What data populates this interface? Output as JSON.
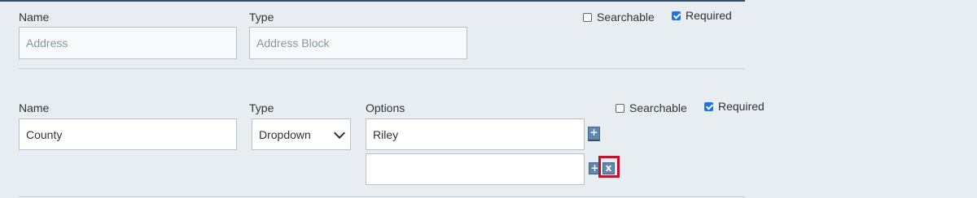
{
  "field1": {
    "name_label": "Name",
    "name_value": "Address",
    "type_label": "Type",
    "type_value": "Address Block",
    "searchable_label": "Searchable",
    "searchable_checked": false,
    "required_label": "Required",
    "required_checked": true
  },
  "field2": {
    "name_label": "Name",
    "name_value": "County",
    "type_label": "Type",
    "type_selected": "Dropdown",
    "options_label": "Options",
    "options": [
      "Riley",
      ""
    ],
    "searchable_label": "Searchable",
    "searchable_checked": false,
    "required_label": "Required",
    "required_checked": true
  },
  "icons": {
    "add_glyph": "+",
    "remove_glyph": "x"
  },
  "colors": {
    "accent": "#2f4f6f",
    "icon_button": "#5f87b0",
    "highlight": "#c0122c",
    "checkbox_checked": "#1a73e8"
  }
}
